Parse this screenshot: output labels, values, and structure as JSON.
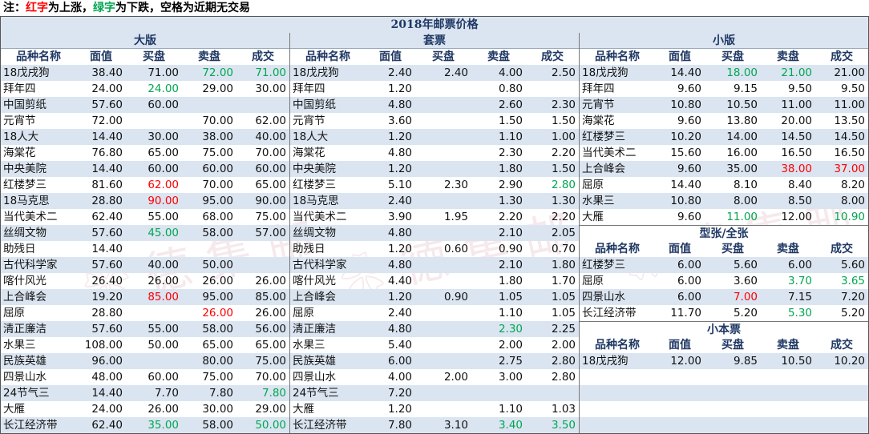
{
  "note": {
    "prefix": "注：",
    "red": "红字",
    "mid1": "为上涨，",
    "green": "绿字",
    "mid2": "为下跌，空格为近期无交易"
  },
  "title": "2018年邮票价格",
  "columns": [
    "品种名称",
    "面值",
    "买盘",
    "卖盘",
    "成交"
  ],
  "panels": {
    "daban": {
      "title": "大版",
      "rows": [
        [
          "18戊戌狗",
          "38.40",
          "71.00",
          "72.00",
          "71.00"
        ],
        [
          "拜年四",
          "24.00",
          "24.00",
          "29.00",
          "30.00"
        ],
        [
          "中国剪纸",
          "57.60",
          "60.00",
          "",
          ""
        ],
        [
          "元宵节",
          "72.00",
          "",
          "70.00",
          "62.00"
        ],
        [
          "18人大",
          "14.40",
          "30.00",
          "38.00",
          "40.00"
        ],
        [
          "海棠花",
          "76.80",
          "65.00",
          "75.00",
          "70.00"
        ],
        [
          "中央美院",
          "14.40",
          "60.00",
          "60.00",
          "60.00"
        ],
        [
          "红楼梦三",
          "81.60",
          "62.00",
          "70.00",
          "65.00"
        ],
        [
          "18马克思",
          "28.80",
          "90.00",
          "95.00",
          "90.00"
        ],
        [
          "当代美术二",
          "62.40",
          "55.00",
          "68.00",
          "75.00"
        ],
        [
          "丝绸文物",
          "57.60",
          "45.00",
          "58.00",
          "57.00"
        ],
        [
          "助残日",
          "14.40",
          "",
          "",
          ""
        ],
        [
          "古代科学家",
          "57.60",
          "40.00",
          "50.00",
          ""
        ],
        [
          "喀什风光",
          "26.40",
          "26.00",
          "26.00",
          "26.00"
        ],
        [
          "上合峰会",
          "19.20",
          "85.00",
          "95.00",
          "85.00"
        ],
        [
          "屈原",
          "28.80",
          "",
          "26.00",
          "26.00"
        ],
        [
          "清正廉洁",
          "57.60",
          "55.00",
          "58.00",
          "56.00"
        ],
        [
          "水果三",
          "108.00",
          "50.00",
          "65.00",
          "65.00"
        ],
        [
          "民族英雄",
          "96.00",
          "",
          "80.00",
          "75.00"
        ],
        [
          "四景山水",
          "48.00",
          "60.00",
          "75.00",
          "70.00"
        ],
        [
          "24节气三",
          "14.40",
          "7.70",
          "7.80",
          "7.80"
        ],
        [
          "大雁",
          "24.00",
          "26.00",
          "30.00",
          "29.00"
        ],
        [
          "长江经济带",
          "62.40",
          "35.00",
          "58.00",
          "50.00"
        ]
      ],
      "colors": [
        [
          "",
          "",
          "",
          "green",
          "green"
        ],
        [
          "",
          "",
          "green",
          "",
          ""
        ],
        [
          "",
          "",
          "",
          "",
          ""
        ],
        [
          "",
          "",
          "",
          "",
          ""
        ],
        [
          "",
          "",
          "",
          "",
          ""
        ],
        [
          "",
          "",
          "",
          "",
          ""
        ],
        [
          "",
          "",
          "",
          "",
          ""
        ],
        [
          "",
          "",
          "red",
          "",
          ""
        ],
        [
          "",
          "",
          "red",
          "",
          ""
        ],
        [
          "",
          "",
          "",
          "",
          ""
        ],
        [
          "",
          "",
          "green",
          "",
          ""
        ],
        [
          "",
          "",
          "",
          "",
          ""
        ],
        [
          "",
          "",
          "",
          "",
          ""
        ],
        [
          "",
          "",
          "",
          "",
          ""
        ],
        [
          "",
          "",
          "red",
          "",
          ""
        ],
        [
          "",
          "",
          "",
          "red",
          ""
        ],
        [
          "",
          "",
          "",
          "",
          ""
        ],
        [
          "",
          "",
          "",
          "",
          ""
        ],
        [
          "",
          "",
          "",
          "",
          ""
        ],
        [
          "",
          "",
          "",
          "",
          ""
        ],
        [
          "",
          "",
          "",
          "",
          "green"
        ],
        [
          "",
          "",
          "",
          "",
          ""
        ],
        [
          "",
          "",
          "green",
          "",
          "green"
        ]
      ]
    },
    "taopiao": {
      "title": "套票",
      "rows": [
        [
          "18戊戌狗",
          "2.40",
          "2.40",
          "4.00",
          "2.50"
        ],
        [
          "拜年四",
          "1.20",
          "",
          "0.80",
          ""
        ],
        [
          "中国剪纸",
          "4.80",
          "",
          "2.60",
          "2.30"
        ],
        [
          "元宵节",
          "3.60",
          "",
          "1.50",
          "1.50"
        ],
        [
          "18人大",
          "1.20",
          "",
          "1.10",
          "1.00"
        ],
        [
          "海棠花",
          "4.80",
          "",
          "2.30",
          "2.20"
        ],
        [
          "中央美院",
          "1.20",
          "",
          "1.80",
          "1.50"
        ],
        [
          "红楼梦三",
          "5.10",
          "2.30",
          "2.90",
          "2.80"
        ],
        [
          "18马克思",
          "2.40",
          "",
          "1.30",
          "1.30"
        ],
        [
          "当代美术二",
          "3.90",
          "1.95",
          "2.20",
          "2.20"
        ],
        [
          "丝绸文物",
          "4.80",
          "",
          "2.10",
          "2.05"
        ],
        [
          "助残日",
          "1.20",
          "0.60",
          "0.90",
          "0.70"
        ],
        [
          "古代科学家",
          "4.80",
          "",
          "2.10",
          "1.80"
        ],
        [
          "喀什风光",
          "4.40",
          "",
          "1.80",
          "1.70"
        ],
        [
          "上合峰会",
          "1.20",
          "0.90",
          "1.05",
          "1.05"
        ],
        [
          "屈原",
          "2.40",
          "",
          "1.10",
          "1.05"
        ],
        [
          "清正廉洁",
          "4.80",
          "",
          "2.30",
          "2.25"
        ],
        [
          "水果三",
          "5.40",
          "",
          "2.00",
          "2.00"
        ],
        [
          "民族英雄",
          "6.00",
          "",
          "2.75",
          "2.80"
        ],
        [
          "四景山水",
          "4.00",
          "2.00",
          "3.00",
          "2.80"
        ],
        [
          "24节气三",
          "7.20",
          "",
          "",
          ""
        ],
        [
          "大雁",
          "1.20",
          "",
          "1.10",
          "1.03"
        ],
        [
          "长江经济带",
          "7.80",
          "3.10",
          "3.40",
          "3.50"
        ]
      ],
      "colors": [
        [
          "",
          "",
          "",
          "",
          ""
        ],
        [
          "",
          "",
          "",
          "",
          ""
        ],
        [
          "",
          "",
          "",
          "",
          ""
        ],
        [
          "",
          "",
          "",
          "",
          ""
        ],
        [
          "",
          "",
          "",
          "",
          ""
        ],
        [
          "",
          "",
          "",
          "",
          ""
        ],
        [
          "",
          "",
          "",
          "",
          ""
        ],
        [
          "",
          "",
          "",
          "",
          "green"
        ],
        [
          "",
          "",
          "",
          "",
          ""
        ],
        [
          "",
          "",
          "",
          "",
          ""
        ],
        [
          "",
          "",
          "",
          "",
          ""
        ],
        [
          "",
          "",
          "",
          "",
          ""
        ],
        [
          "",
          "",
          "",
          "",
          ""
        ],
        [
          "",
          "",
          "",
          "",
          ""
        ],
        [
          "",
          "",
          "",
          "",
          ""
        ],
        [
          "",
          "",
          "",
          "",
          ""
        ],
        [
          "",
          "",
          "",
          "green",
          ""
        ],
        [
          "",
          "",
          "",
          "",
          ""
        ],
        [
          "",
          "",
          "",
          "",
          ""
        ],
        [
          "",
          "",
          "",
          "",
          ""
        ],
        [
          "",
          "",
          "",
          "",
          ""
        ],
        [
          "",
          "",
          "",
          "",
          ""
        ],
        [
          "",
          "",
          "",
          "green",
          "green"
        ]
      ]
    },
    "xiaoban": {
      "title": "小版",
      "rows": [
        [
          "18戊戌狗",
          "14.40",
          "18.00",
          "21.00",
          "21.00"
        ],
        [
          "拜年四",
          "9.60",
          "9.15",
          "9.50",
          "9.50"
        ],
        [
          "元宵节",
          "10.80",
          "10.50",
          "11.00",
          "11.00"
        ],
        [
          "海棠花",
          "9.60",
          "13.80",
          "20.00",
          "13.50"
        ],
        [
          "红楼梦三",
          "10.20",
          "14.00",
          "14.50",
          "14.50"
        ],
        [
          "当代美术二",
          "15.60",
          "16.00",
          "16.50",
          "16.50"
        ],
        [
          "上合峰会",
          "9.60",
          "35.00",
          "38.00",
          "37.00"
        ],
        [
          "屈原",
          "14.40",
          "8.10",
          "8.40",
          "8.20"
        ],
        [
          "水果三",
          "10.80",
          "8.00",
          "8.50",
          "8.00"
        ],
        [
          "大雁",
          "9.60",
          "11.00",
          "12.00",
          "10.90"
        ]
      ],
      "colors": [
        [
          "",
          "",
          "green",
          "green",
          ""
        ],
        [
          "",
          "",
          "",
          "",
          ""
        ],
        [
          "",
          "",
          "",
          "",
          ""
        ],
        [
          "",
          "",
          "",
          "",
          ""
        ],
        [
          "",
          "",
          "",
          "",
          ""
        ],
        [
          "",
          "",
          "",
          "",
          ""
        ],
        [
          "",
          "",
          "",
          "red",
          "red"
        ],
        [
          "",
          "",
          "",
          "",
          ""
        ],
        [
          "",
          "",
          "",
          "",
          ""
        ],
        [
          "",
          "",
          "green",
          "",
          "green"
        ]
      ]
    },
    "xingzhang": {
      "title": "型张/全张",
      "rows": [
        [
          "红楼梦三",
          "6.00",
          "5.60",
          "6.00",
          "5.60"
        ],
        [
          "屈原",
          "6.00",
          "3.60",
          "3.70",
          "3.65"
        ],
        [
          "四景山水",
          "6.00",
          "7.00",
          "7.15",
          "7.20"
        ],
        [
          "长江经济带",
          "11.70",
          "5.20",
          "5.30",
          "5.20"
        ]
      ],
      "colors": [
        [
          "",
          "",
          "",
          "",
          ""
        ],
        [
          "",
          "",
          "",
          "green",
          "green"
        ],
        [
          "",
          "",
          "red",
          "",
          ""
        ],
        [
          "",
          "",
          "",
          "green",
          ""
        ]
      ]
    },
    "xiaobenpiao": {
      "title": "小本票",
      "rows": [
        [
          "18戊戌狗",
          "12.00",
          "9.85",
          "10.50",
          "10.20"
        ]
      ],
      "colors": [
        [
          "",
          "",
          "",
          "",
          ""
        ]
      ]
    }
  },
  "colors": {
    "header_bg": "#dbe5f1",
    "alt_row_bg": "#dbe5f1",
    "header_text": "#1f3864",
    "up": "#ff0000",
    "down": "#00a651"
  }
}
